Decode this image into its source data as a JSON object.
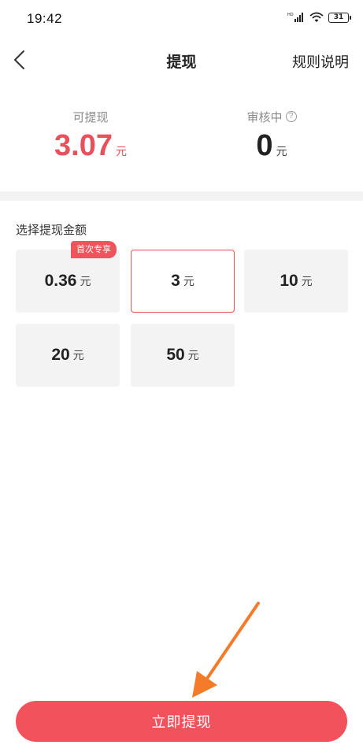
{
  "status_bar": {
    "time": "19:42",
    "battery": "31"
  },
  "nav": {
    "title": "提现",
    "rules_label": "规则说明"
  },
  "balance": {
    "withdrawable_label": "可提现",
    "withdrawable_amount": "3.07",
    "withdrawable_unit": "元",
    "pending_label": "审核中",
    "pending_amount": "0",
    "pending_unit": "元"
  },
  "amounts": {
    "title": "选择提现金额",
    "badge": "首次专享",
    "selected_index": 1,
    "options": [
      {
        "value": "0.36",
        "unit": "元"
      },
      {
        "value": "3",
        "unit": "元"
      },
      {
        "value": "10",
        "unit": "元"
      },
      {
        "value": "20",
        "unit": "元"
      },
      {
        "value": "50",
        "unit": "元"
      }
    ]
  },
  "withdraw_button": {
    "label": "立即提现"
  },
  "colors": {
    "accent": "#f1525c",
    "amount_red": "#e8505b",
    "annotation_arrow": "#f47b2a"
  }
}
